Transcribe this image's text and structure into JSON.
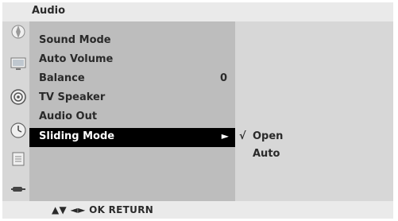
{
  "title": "Audio",
  "menu": [
    {
      "label": "Sound Mode",
      "value": ""
    },
    {
      "label": "Auto Volume",
      "value": ""
    },
    {
      "label": "Balance",
      "value": "0"
    },
    {
      "label": "TV Speaker",
      "value": ""
    },
    {
      "label": "Audio Out",
      "value": ""
    },
    {
      "label": "Sliding Mode",
      "value": ""
    }
  ],
  "selected_arrow": "►",
  "submenu": {
    "check": "√",
    "options": [
      "Open",
      "Auto"
    ]
  },
  "footer": "▲▼  ◄►  OK  RETURN",
  "icons": [
    "picture-settings-icon",
    "screen-icon",
    "audio-icon",
    "time-icon",
    "option-icon",
    "input-icon"
  ],
  "colors": {
    "selected_bg": "#000000",
    "menu_bg": "#bdbdbd",
    "panel_bg": "#d7d7d7",
    "bar_bg": "#eaeaea"
  }
}
